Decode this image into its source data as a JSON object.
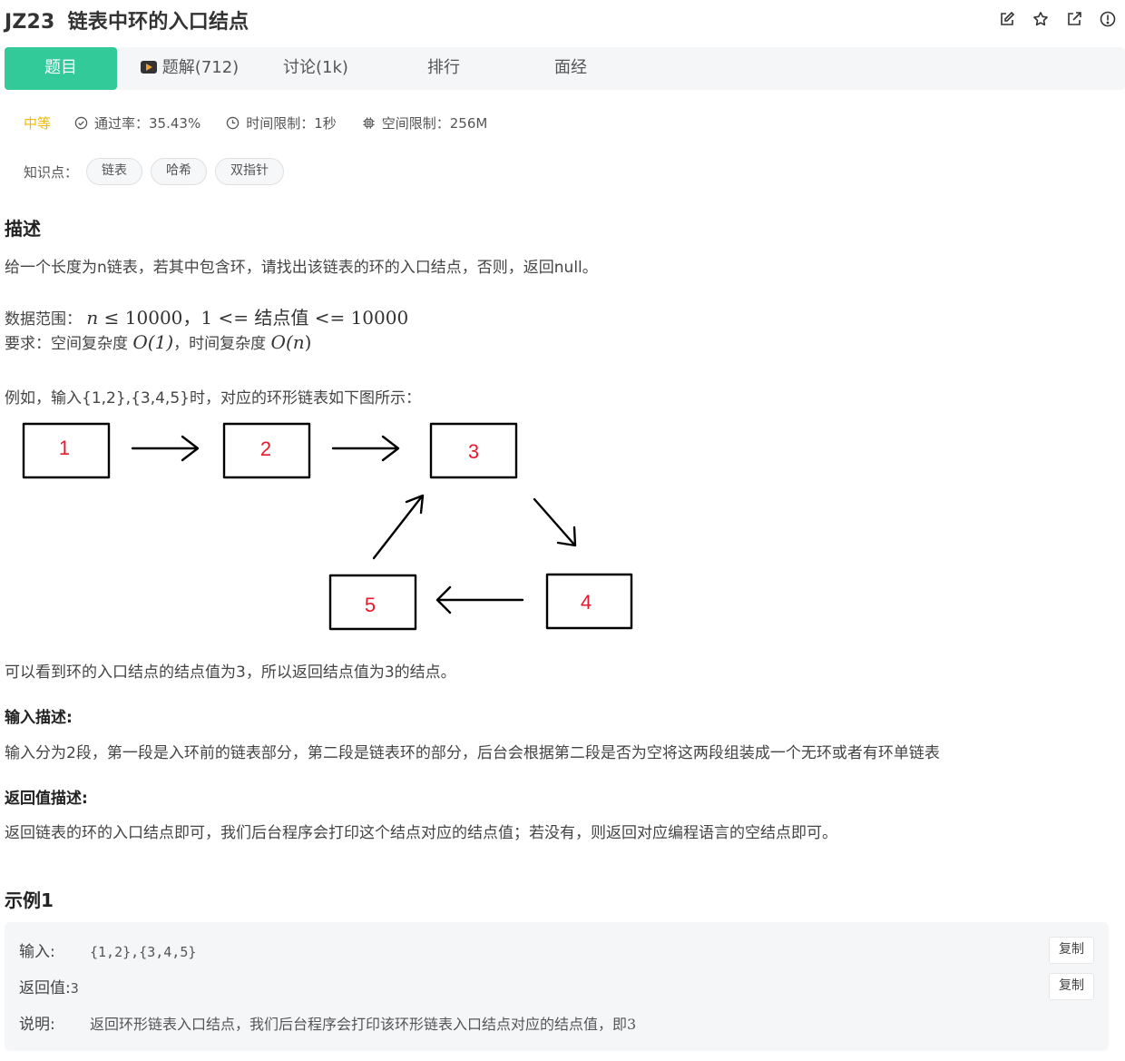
{
  "header": {
    "problem_id": "JZ23",
    "title": "链表中环的入口结点",
    "icons": [
      "edit-icon",
      "star-icon",
      "share-icon",
      "report-icon"
    ]
  },
  "tabs": [
    {
      "label": "题目",
      "active": true
    },
    {
      "label": "题解(712)",
      "active": false
    },
    {
      "label": "讨论(1k)",
      "active": false
    },
    {
      "label": "排行",
      "active": false
    },
    {
      "label": "面经",
      "active": false
    }
  ],
  "meta": {
    "difficulty": "中等",
    "pass_rate": "通过率：35.43%",
    "time_limit": "时间限制：1秒",
    "space_limit": "空间限制：256M"
  },
  "knowledge": {
    "label": "知识点：",
    "tags": [
      "链表",
      "哈希",
      "双指针"
    ]
  },
  "description": {
    "heading": "描述",
    "intro": "给一个长度为n链表，若其中包含环，请找出该链表的环的入口结点，否则，返回null。",
    "range_label": "数据范围：",
    "range_n": "n",
    "range_expr": "≤ 10000，1 <= 结点值 <= 10000",
    "req_label": "要求：空间复杂度",
    "req_space": "O(1)",
    "req_mid": "，时间复杂度",
    "req_time_O": "O(",
    "req_time_n": "n",
    "req_time_close": ")",
    "example_intro": "例如，输入{1,2},{3,4,5}时，对应的环形链表如下图所示：",
    "diagram_nodes": [
      "1",
      "2",
      "3",
      "4",
      "5"
    ],
    "after_diagram": "可以看到环的入口结点的结点值为3，所以返回结点值为3的结点。"
  },
  "input_desc": {
    "heading": "输入描述:",
    "text": "输入分为2段，第一段是入环前的链表部分，第二段是链表环的部分，后台会根据第二段是否为空将这两段组装成一个无环或者有环单链表"
  },
  "return_desc": {
    "heading": "返回值描述:",
    "text": "返回链表的环的入口结点即可，我们后台程序会打印这个结点对应的结点值；若没有，则返回对应编程语言的空结点即可。"
  },
  "example1": {
    "heading": "示例1",
    "input_label": "输入:",
    "input_value": "{1,2},{3,4,5}",
    "return_label": "返回值:",
    "return_value": "3",
    "explain_label": "说明:",
    "explain_value": "返回环形链表入口结点，我们后台程序会打印该环形链表入口结点对应的结点值，即3",
    "copy_label": "复制"
  },
  "colors": {
    "accent": "#32ca99",
    "difficulty": "#f2b80a",
    "node_text": "#e8192c"
  }
}
